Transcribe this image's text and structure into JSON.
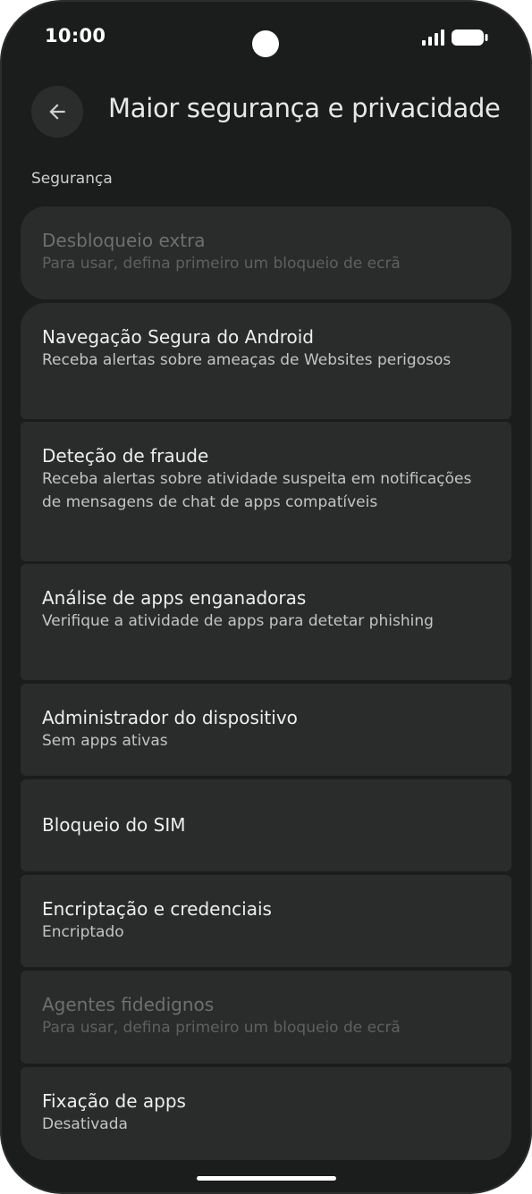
{
  "status_bar": {
    "time": "10:00"
  },
  "header": {
    "title": "Maior segurança e privacidade",
    "back_icon": "arrow-back-icon"
  },
  "section": {
    "label": "Segurança"
  },
  "items": [
    {
      "title": "Desbloqueio extra",
      "summary": "Para usar, defina primeiro um bloqueio de ecrã",
      "enabled": false
    },
    {
      "title": "Navegação Segura do Android",
      "summary": "Receba alertas sobre ameaças de Websites perigosos",
      "enabled": true
    },
    {
      "title": "Deteção de fraude",
      "summary": "Receba alertas sobre atividade suspeita em notificações de mensagens de chat de apps compatíveis",
      "enabled": true
    },
    {
      "title": "Análise de apps enganadoras",
      "summary": "Verifique a atividade de apps para detetar phishing",
      "enabled": true
    },
    {
      "title": "Administrador do dispositivo",
      "summary": "Sem apps ativas",
      "enabled": true
    },
    {
      "title": "Bloqueio do SIM",
      "summary": "",
      "enabled": true
    },
    {
      "title": "Encriptação e credenciais",
      "summary": "Encriptado",
      "enabled": true
    },
    {
      "title": "Agentes fidedignos",
      "summary": "Para usar, defina primeiro um bloqueio de ecrã",
      "enabled": false
    },
    {
      "title": "Fixação de apps",
      "summary": "Desativada",
      "enabled": true
    }
  ],
  "colors": {
    "background": "#1b1c1c",
    "card": "#2a2b2b",
    "title_text": "#eeeeee",
    "summary_text": "#c4c4c4",
    "disabled_text": "#6e6f6f"
  }
}
